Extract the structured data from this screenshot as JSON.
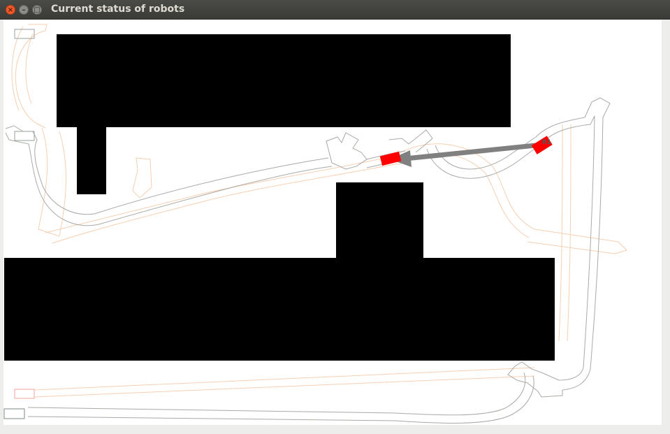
{
  "window": {
    "title": "Current status of robots",
    "controls": {
      "close_icon": "close-icon",
      "minimize_icon": "minimize-icon",
      "maximize_icon": "maximize-icon",
      "close_glyph": "×",
      "minimize_glyph": "–",
      "maximize_glyph": "□"
    }
  },
  "map": {
    "colors": {
      "background": "#ffffff",
      "obstacle": "#000000",
      "path_gray": "#a8aaa4",
      "path_orange": "#f5c8a8",
      "robot": "#ff0000",
      "arrow": "#808080"
    },
    "robots": [
      {
        "id": "R1",
        "label": "R1",
        "icon": "robot-rect"
      }
    ],
    "target_icon": "robot-target-rect",
    "heading_icon": "arrow-left-icon"
  }
}
